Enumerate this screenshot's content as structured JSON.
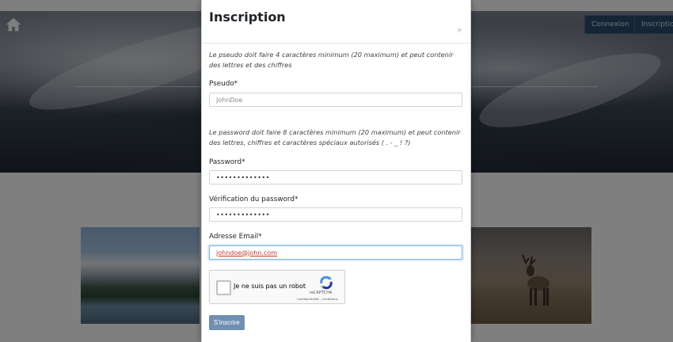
{
  "navbar": {
    "home_icon": "home-icon",
    "login_label": "Connexion",
    "signup_label": "Inscription"
  },
  "modal": {
    "title": "Inscription",
    "close_label": "×",
    "pseudo_help": "Le pseudo doit faire 4 caractères minimum (20 maximum) et peut contenir des lettres et des chiffres",
    "pseudo_label": "Pseudo*",
    "pseudo_placeholder": "JohnDoe",
    "password_help": "Le password doit faire 8 caractères minimum (20 maximum) et peut contenir des lettres, chiffres et caractères spéciaux autorisés ( . - _ ! ?)",
    "password_label": "Password*",
    "password_value": "•••••••••••••",
    "password_confirm_label": "Vérification du password*",
    "password_confirm_value": "•••••••••••••",
    "email_label": "Adresse Email*",
    "email_value": "johndoe@john.com",
    "captcha": {
      "text": "Je ne suis pas un robot",
      "brand": "reCAPTCHA",
      "links": "Confidentialité - Conditions"
    },
    "submit_label": "S'inscrire"
  },
  "colors": {
    "nav_button": "#2b4a6b",
    "submit_button": "#6f8fb4",
    "focus_border": "#7db3e8"
  }
}
